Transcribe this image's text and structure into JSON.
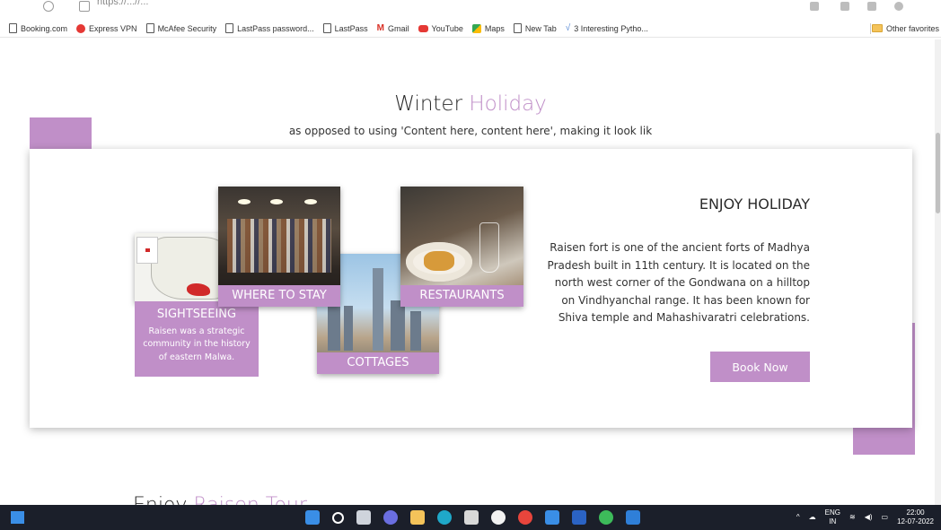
{
  "browser": {
    "url": "https://...//...",
    "bookmarks": [
      {
        "label": "Booking.com",
        "icon": "page-icon"
      },
      {
        "label": "Express VPN",
        "icon": "expressvpn-icon"
      },
      {
        "label": "McAfee Security",
        "icon": "page-icon"
      },
      {
        "label": "LastPass password...",
        "icon": "page-icon"
      },
      {
        "label": "LastPass",
        "icon": "page-icon"
      },
      {
        "label": "Gmail",
        "icon": "gmail-icon"
      },
      {
        "label": "YouTube",
        "icon": "youtube-icon"
      },
      {
        "label": "Maps",
        "icon": "maps-icon"
      },
      {
        "label": "New Tab",
        "icon": "page-icon"
      },
      {
        "label": "3 Interesting Pytho...",
        "icon": "python-icon"
      }
    ],
    "other_favorites": "Other favorites"
  },
  "section": {
    "title_main": "Winter",
    "title_accent": "Holiday",
    "subtitle": "as opposed to using 'Content here, content here', making it look lik"
  },
  "tiles": {
    "sightseeing": {
      "label": "SIGHTSEEING",
      "desc": "Raisen was a strategic community in the history of eastern Malwa."
    },
    "stay": {
      "label": "WHERE TO STAY"
    },
    "cottages": {
      "label": "COTTAGES"
    },
    "restaurants": {
      "label": "RESTAURANTS"
    }
  },
  "enjoy": {
    "title": "ENJOY HOLIDAY",
    "text": "Raisen fort is one of the ancient forts of Madhya Pradesh built in 11th century. It is located on the north west corner of the Gondwana on a hilltop on Vindhyanchal range. It has been known for Shiva temple and Mahashivaratri celebrations.",
    "button": "Book Now"
  },
  "next_section": {
    "title_main": "Enjoy",
    "title_accent": "Raisen Tour"
  },
  "taskbar": {
    "language": "ENG",
    "region": "IN",
    "time": "22:00",
    "date": "12-07-2022"
  },
  "colors": {
    "accent": "#c08fc8",
    "taskbar": "#1b1f2a"
  }
}
